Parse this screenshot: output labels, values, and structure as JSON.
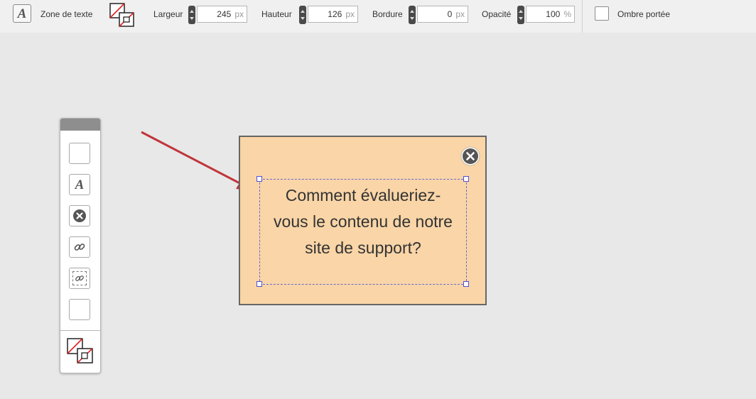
{
  "toolbar": {
    "text_zone_label": "Zone de texte",
    "width": {
      "label": "Largeur",
      "value": "245",
      "unit": "px"
    },
    "height": {
      "label": "Hauteur",
      "value": "126",
      "unit": "px"
    },
    "border": {
      "label": "Bordure",
      "value": "0",
      "unit": "px"
    },
    "opacity": {
      "label": "Opacité",
      "value": "100",
      "unit": "%"
    },
    "shadow": {
      "label": "Ombre portée",
      "checked": false
    }
  },
  "palette": {
    "tools": [
      "rectangle-tool",
      "text-tool",
      "close-button-tool",
      "link-tool",
      "link-zone-tool",
      "blank-tool"
    ]
  },
  "canvas": {
    "text_lines": [
      "Comment évalueriez-",
      "vous le contenu de notre",
      "site de support?"
    ],
    "box_color": "#f9d5a7",
    "arrow_color": "#c0353a",
    "selection_color": "#4f4fcf"
  }
}
